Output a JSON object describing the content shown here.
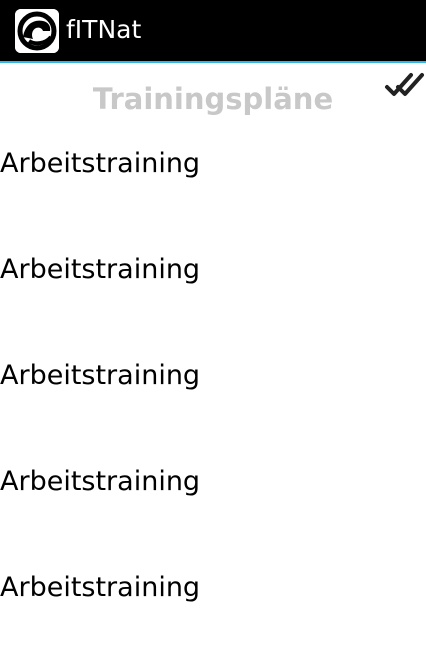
{
  "actionbar": {
    "title": "fITNat",
    "accent_color": "#33b5e5"
  },
  "page": {
    "title": "Trainingspläne",
    "title_color": "#c8c8c8"
  },
  "header_icons": {
    "right": "double-check-icon"
  },
  "plans": [
    {
      "label": "Arbeitstraining"
    },
    {
      "label": "Arbeitstraining"
    },
    {
      "label": "Arbeitstraining"
    },
    {
      "label": "Arbeitstraining"
    },
    {
      "label": "Arbeitstraining"
    }
  ]
}
